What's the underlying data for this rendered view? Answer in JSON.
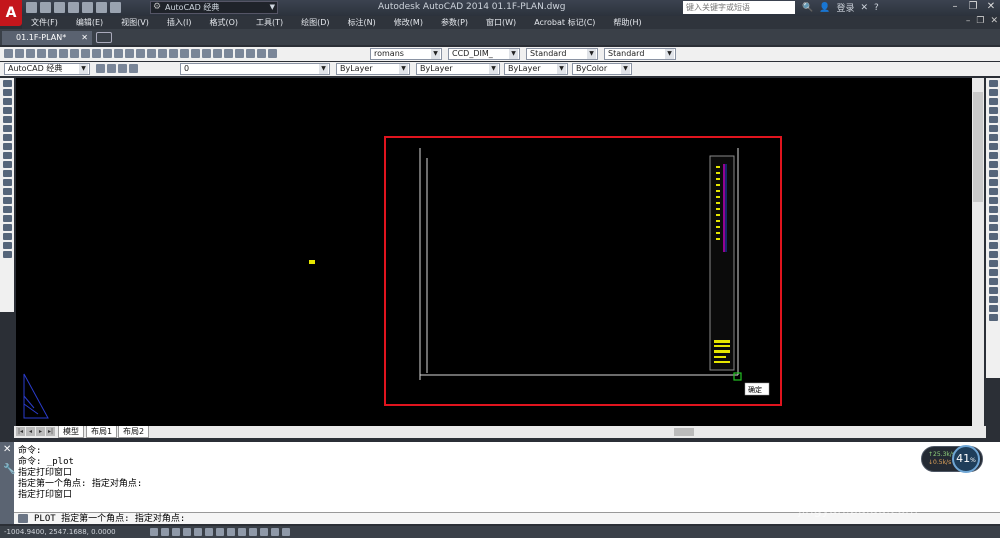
{
  "app": {
    "logo_letter": "A",
    "title": "Autodesk AutoCAD 2014   01.1F-PLAN.dwg",
    "workspace": "AutoCAD 经典",
    "search_placeholder": "键入关键字或短语",
    "user": "登录"
  },
  "menu": [
    "文件(F)",
    "编辑(E)",
    "视图(V)",
    "插入(I)",
    "格式(O)",
    "工具(T)",
    "绘图(D)",
    "标注(N)",
    "修改(M)",
    "参数(P)",
    "窗口(W)",
    "Acrobat 标记(C)",
    "帮助(H)"
  ],
  "file_tab": {
    "label": "01.1F-PLAN*",
    "close": "✕"
  },
  "toolbar": {
    "text_style": "romans",
    "dim_style": "CCD_DIM_",
    "table_style": "Standard",
    "mleader_style": "Standard",
    "workspace2": "AutoCAD 经典",
    "layer": "0",
    "color": "ByLayer",
    "linetype": "ByLayer",
    "lineweight": "ByLayer",
    "plotstyle": "ByColor"
  },
  "canvas": {
    "tooltip": "确定",
    "colors": {
      "selection": "#e0141e",
      "magenta": "#c000c0",
      "yellow": "#e6e600",
      "green": "#23c023",
      "blue": "#2a3ccc"
    }
  },
  "layout_tabs": [
    "模型",
    "布局1",
    "布局2"
  ],
  "command": {
    "history": [
      "命令:",
      "命令: _plot",
      "指定打印窗口",
      "指定第一个角点: 指定对角点:",
      "指定打印窗口"
    ],
    "input": "PLOT 指定第一个角点: 指定对角点:"
  },
  "status": {
    "coords": "-1004.9400, 2547.1688, 0.0000"
  },
  "perf": {
    "value": "41",
    "unit": "%",
    "up": "↑25.3k/s",
    "down": "↓0.5k/s"
  },
  "watermark": {
    "brand": "Baidu经验",
    "url": "jingyan.baidu.com"
  }
}
